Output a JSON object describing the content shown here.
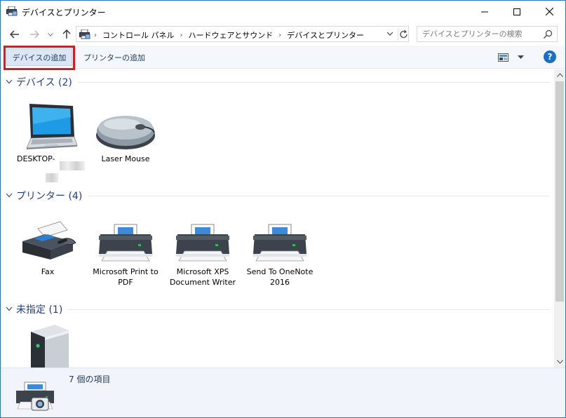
{
  "window": {
    "title": "デバイスとプリンター",
    "controls": {
      "minimize": "minimize",
      "maximize": "maximize",
      "close": "close"
    }
  },
  "navigation": {
    "breadcrumbs": [
      "コントロール パネル",
      "ハードウェアとサウンド",
      "デバイスとプリンター"
    ],
    "search_placeholder": "デバイスとプリンターの検索"
  },
  "command_bar": {
    "add_device": "デバイスの追加",
    "add_printer": "プリンターの追加"
  },
  "groups": [
    {
      "label": "デバイス (2)",
      "items": [
        {
          "label": "DESKTOP-",
          "icon": "laptop-icon"
        },
        {
          "label": "Laser Mouse",
          "icon": "mouse-icon"
        }
      ]
    },
    {
      "label": "プリンター (4)",
      "items": [
        {
          "label": "Fax",
          "icon": "fax-icon"
        },
        {
          "label": "Microsoft Print to PDF",
          "icon": "printer-icon"
        },
        {
          "label": "Microsoft XPS Document Writer",
          "icon": "printer-icon"
        },
        {
          "label": "Send To OneNote 2016",
          "icon": "printer-icon"
        }
      ]
    },
    {
      "label": "未指定 (1)",
      "items": [
        {
          "label": "",
          "icon": "server-tower-icon"
        }
      ]
    }
  ],
  "details": {
    "count_text": "7 個の項目"
  },
  "colors": {
    "accent": "#1a6ec8",
    "highlight_box": "#e8141b",
    "group_header": "#1e3f85",
    "command_bar_bg": "#f4f7fc"
  }
}
